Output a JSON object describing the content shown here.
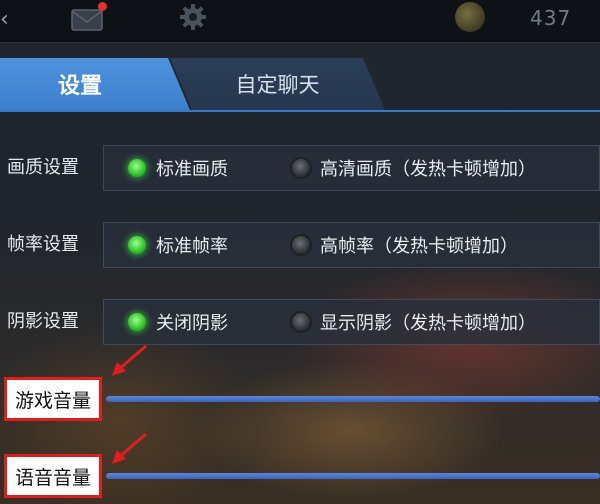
{
  "topbar": {
    "back_icon": "chevron-left-icon",
    "mail_icon": "mail-icon",
    "settings_icon": "gear-icon",
    "coin_icon": "coin-icon",
    "coin_count": "437"
  },
  "tabs": [
    {
      "label": "设置",
      "active": true
    },
    {
      "label": "自定聊天",
      "active": false
    }
  ],
  "settings": [
    {
      "label": "画质设置",
      "options": [
        {
          "label": "标准画质",
          "selected": true
        },
        {
          "label": "高清画质（发热卡顿增加）",
          "selected": false
        }
      ]
    },
    {
      "label": "帧率设置",
      "options": [
        {
          "label": "标准帧率",
          "selected": true
        },
        {
          "label": "高帧率（发热卡顿增加）",
          "selected": false
        }
      ]
    },
    {
      "label": "阴影设置",
      "options": [
        {
          "label": "关闭阴影",
          "selected": true
        },
        {
          "label": "显示阴影（发热卡顿增加）",
          "selected": false
        }
      ]
    }
  ],
  "volume": [
    {
      "label": "游戏音量"
    },
    {
      "label": "语音音量"
    }
  ],
  "colors": {
    "accent": "#4a8ad8",
    "radio_on": "#2fbf2a",
    "annotation": "#e01e1e"
  }
}
